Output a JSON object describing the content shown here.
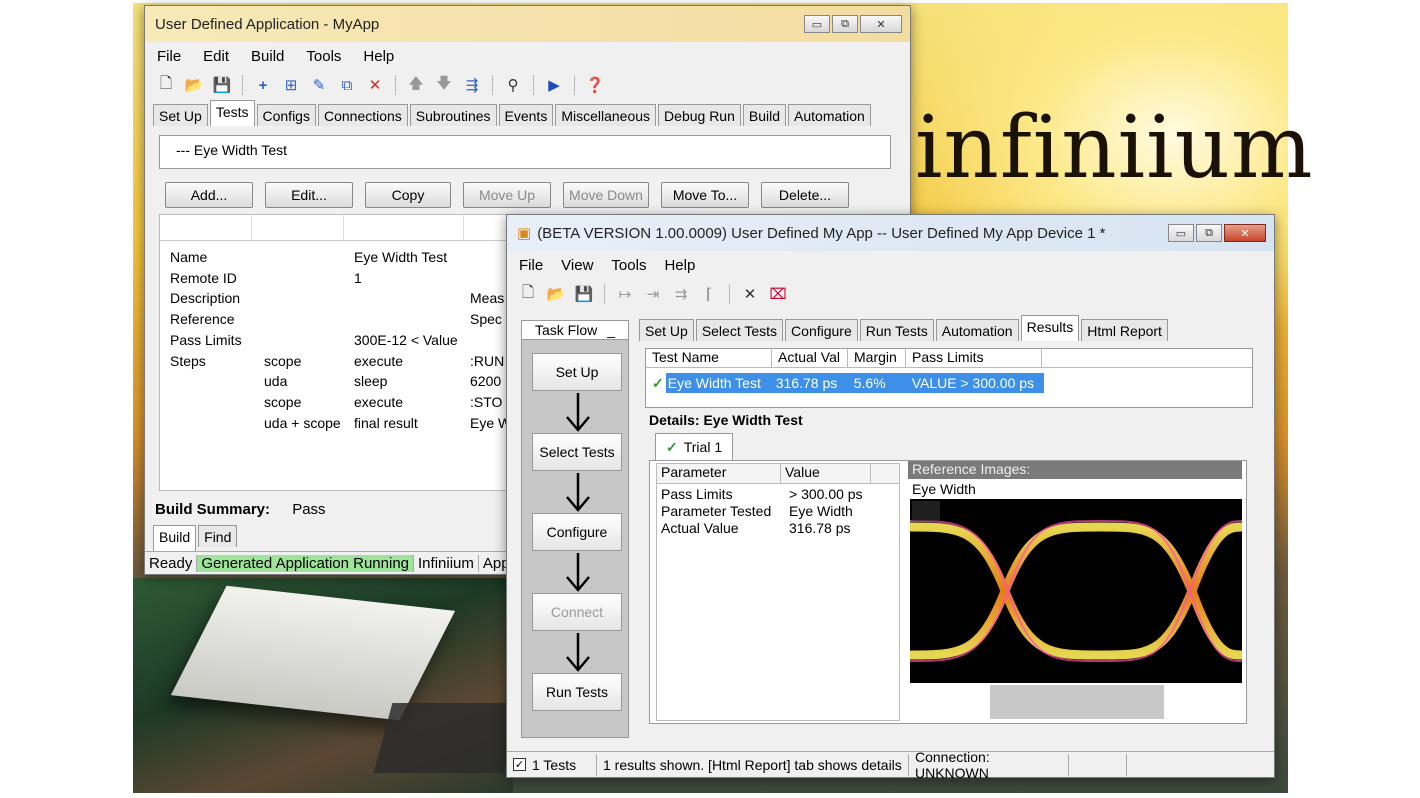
{
  "brand": {
    "logo_text": "infiniium"
  },
  "win1": {
    "title": "User Defined Application - MyApp",
    "title_buttons": [
      "▭",
      "⧉",
      "✕"
    ],
    "menu": [
      "File",
      "Edit",
      "Build",
      "Tools",
      "Help"
    ],
    "tabs": [
      "Set Up",
      "Tests",
      "Configs",
      "Connections",
      "Subroutines",
      "Events",
      "Miscellaneous",
      "Debug Run",
      "Build",
      "Automation"
    ],
    "active_tab": "Tests",
    "tree_item": "--- Eye Width Test",
    "buttons": [
      "Add...",
      "Edit...",
      "Copy",
      "Move Up",
      "Move Down",
      "Move To...",
      "Delete..."
    ],
    "props": [
      {
        "name": "Name",
        "c2": "",
        "c3": "Eye Width Test",
        "c4": ""
      },
      {
        "name": "Remote ID",
        "c2": "",
        "c3": "1",
        "c4": ""
      },
      {
        "name": "Description",
        "c2": "",
        "c3": "",
        "c4": "Meas"
      },
      {
        "name": "Reference",
        "c2": "",
        "c3": "",
        "c4": "Spec"
      },
      {
        "name": "Pass Limits",
        "c2": "",
        "c3": "300E-12 < Value",
        "c4": ""
      },
      {
        "name": "Steps",
        "c2": "scope",
        "c3": "execute",
        "c4": ":RUN"
      },
      {
        "name": "",
        "c2": "uda",
        "c3": "sleep",
        "c4": "6200"
      },
      {
        "name": "",
        "c2": "scope",
        "c3": "execute",
        "c4": ":STO"
      },
      {
        "name": "",
        "c2": "uda + scope",
        "c3": "final result",
        "c4": "Eye W"
      }
    ],
    "build_summary_label": "Build Summary:",
    "build_summary_value": "Pass",
    "bottom_tabs": [
      "Build",
      "Find"
    ],
    "status": [
      "Ready",
      "Generated Application Running",
      "Infiniium",
      "App"
    ]
  },
  "win2": {
    "title": "(BETA VERSION 1.00.0009) User Defined My App -- User Defined My App Device 1 *",
    "title_buttons": [
      "▭",
      "⧉",
      "✕"
    ],
    "menu": [
      "File",
      "View",
      "Tools",
      "Help"
    ],
    "task_flow": "Task Flow",
    "task_flow_pin": "_",
    "flow_steps": [
      {
        "label": "Set Up",
        "enabled": true
      },
      {
        "label": "Select Tests",
        "enabled": true
      },
      {
        "label": "Configure",
        "enabled": true
      },
      {
        "label": "Connect",
        "enabled": false
      },
      {
        "label": "Run Tests",
        "enabled": true
      }
    ],
    "tabs": [
      "Set Up",
      "Select Tests",
      "Configure",
      "Run Tests",
      "Automation",
      "Results",
      "Html Report"
    ],
    "active_tab": "Results",
    "results_columns": [
      "Test Name",
      "Actual Val",
      "Margin",
      "Pass Limits"
    ],
    "result_row": {
      "name": "Eye Width Test",
      "actual": "316.78 ps",
      "margin": "5.6%",
      "limits": "VALUE > 300.00 ps"
    },
    "details_title": "Details: Eye Width Test",
    "trial_tab": "Trial 1",
    "param_columns": [
      "Parameter",
      "Value"
    ],
    "params": [
      {
        "p": "Pass Limits",
        "v": "> 300.00 ps"
      },
      {
        "p": "Parameter Tested",
        "v": "Eye Width"
      },
      {
        "p": "Actual Value",
        "v": "316.78 ps"
      }
    ],
    "ref_header": "Reference Images:",
    "ref_name": "Eye Width",
    "status": [
      "1 Tests",
      "1 results shown. [Html Report] tab shows details",
      "Connection: UNKNOWN"
    ],
    "status_checked": "✓"
  },
  "colors": {
    "selection": "#3e8fe8",
    "running_green": "#9ee39a",
    "pass_check": "#2f9a3a"
  }
}
